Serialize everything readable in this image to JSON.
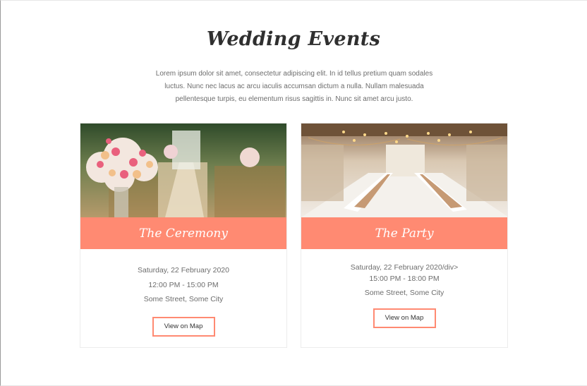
{
  "header": {
    "title": "Wedding Events",
    "intro": "Lorem ipsum dolor sit amet, consectetur adipiscing elit. In id tellus pretium quam sodales luctus. Nunc nec lacus ac arcu iaculis accumsan dictum a nulla. Nullam malesuada pellentesque turpis, eu elementum risus sagittis in. Nunc sit amet arcu justo."
  },
  "events": [
    {
      "title": "The Ceremony",
      "date": "Saturday, 22 February 2020",
      "time": "12:00 PM - 15:00 PM",
      "location": "Some Street, Some City",
      "button_label": "View on Map"
    },
    {
      "title": "The Party",
      "date": "Saturday, 22 February 2020/div>",
      "time": "15:00 PM - 18:00 PM",
      "location": "Some Street, Some City",
      "button_label": "View on Map"
    }
  ],
  "colors": {
    "accent": "#ff8a72",
    "heading": "#2f2f2f",
    "body_text": "#6d6d6d"
  }
}
